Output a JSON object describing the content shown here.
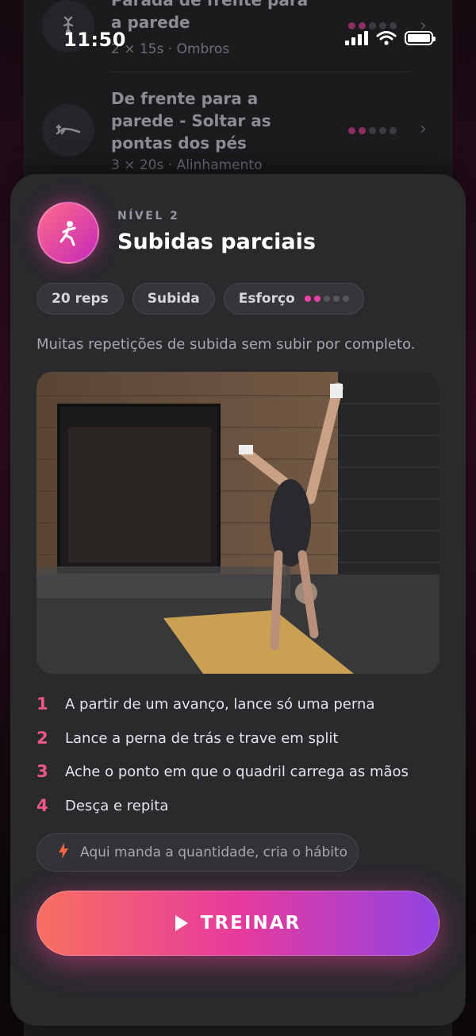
{
  "status_bar": {
    "time": "11:50"
  },
  "background_list": {
    "items": [
      {
        "title": "Parada de frente para a parede",
        "meta": "2 × 15s · Ombros",
        "icon": "handstand-icon"
      },
      {
        "title": "De frente para a parede - Soltar as pontas dos pés",
        "meta": "3 × 20s · Alinhamento",
        "icon": "plank-icon"
      }
    ]
  },
  "sheet": {
    "level_label": "NÍVEL 2",
    "title": "Subidas parciais",
    "chips": {
      "reps": "20 reps",
      "type": "Subida",
      "effort_label": "Esforço"
    },
    "effort_level": 2,
    "effort_max": 5,
    "description": "Muitas repetições de subida sem subir por completo.",
    "steps": [
      {
        "num": "1",
        "text": "A partir de um avanço, lance só uma perna"
      },
      {
        "num": "2",
        "text": "Lance a perna de trás e trave em split"
      },
      {
        "num": "3",
        "text": "Ache o ponto em que o quadril carrega as mãos"
      },
      {
        "num": "4",
        "text": "Desça e repita"
      }
    ],
    "tip": "Aqui manda a quantidade, cria o hábito",
    "cta_label": "TREINAR"
  },
  "colors": {
    "accent_pink": "#f0568a",
    "cta_gradient_start": "#f86f61",
    "cta_gradient_mid": "#e73a9d",
    "cta_gradient_end": "#9143e2",
    "sheet_bg": "#2a292c"
  }
}
